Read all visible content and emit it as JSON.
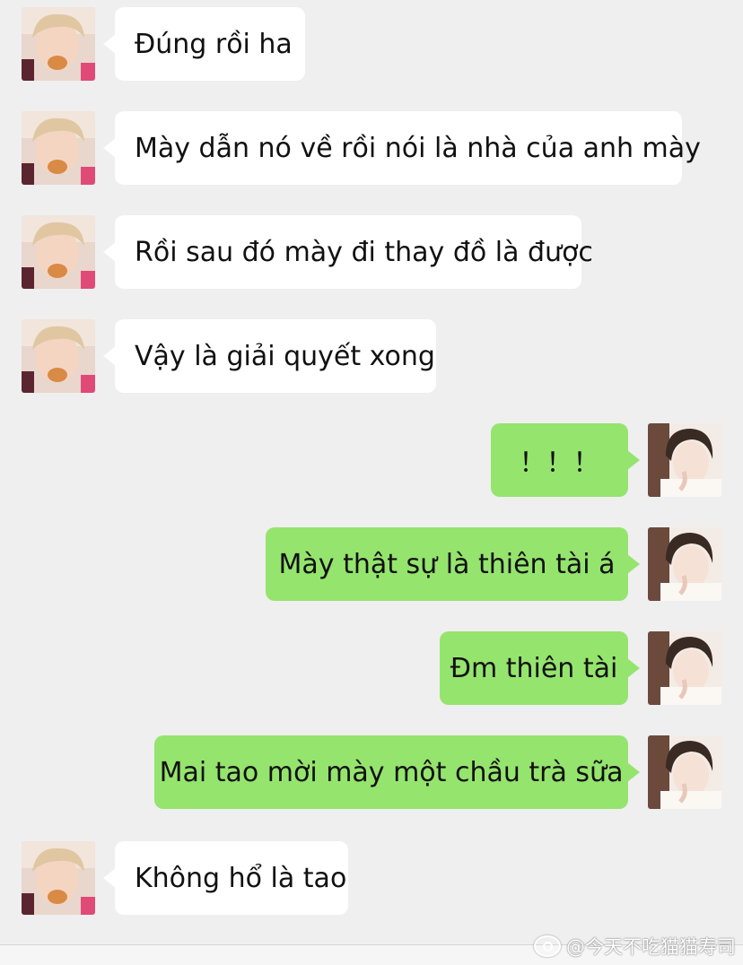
{
  "colors": {
    "background": "#efefef",
    "incoming": "#ffffff",
    "outgoing": "#95e46e"
  },
  "messages": [
    {
      "side": "left",
      "text": "Đúng rồi ha"
    },
    {
      "side": "left",
      "text": "Mày dẫn nó về rồi nói là nhà của anh mày"
    },
    {
      "side": "left",
      "text": "Rồi sau đó mày đi thay đồ là được"
    },
    {
      "side": "left",
      "text": "Vậy là giải quyết xong"
    },
    {
      "side": "right",
      "text": "！！！"
    },
    {
      "side": "right",
      "text": "Mày thật sự là thiên tài á"
    },
    {
      "side": "right",
      "text": "Đm thiên tài"
    },
    {
      "side": "right",
      "text": "Mai tao mời mày một chầu trà sữa"
    },
    {
      "side": "left",
      "text": "Không hổ là tao"
    }
  ],
  "watermark": {
    "text": "@今天不吃猫猫寿司",
    "icon": "weibo-icon"
  }
}
